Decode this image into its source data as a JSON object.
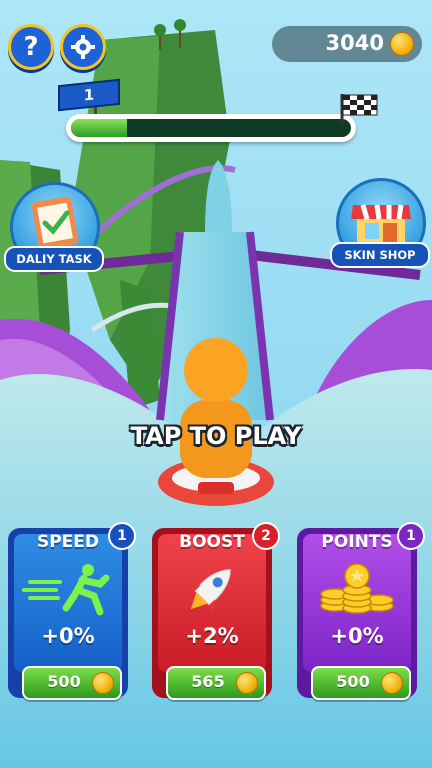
{
  "hud": {
    "coins": "3040",
    "level": "1",
    "progress": 0.2
  },
  "side_buttons": {
    "daily_task": "DALIY TASK",
    "skin_shop": "SKIN SHOP"
  },
  "prompt": "TAP TO PLAY",
  "upgrades": [
    {
      "title": "SPEED",
      "badge": "1",
      "value": "+0%",
      "price": "500"
    },
    {
      "title": "BOOST",
      "badge": "2",
      "value": "+2%",
      "price": "565"
    },
    {
      "title": "POINTS",
      "badge": "1",
      "value": "+0%",
      "price": "500"
    }
  ],
  "colors": {
    "sky": "#8fd8f2",
    "water": "#8fd9e8",
    "speed_card": "#1f6fd8",
    "boost_card": "#e0303a",
    "points_card": "#9a3ddb",
    "buy_button": "#4cbc2f"
  }
}
